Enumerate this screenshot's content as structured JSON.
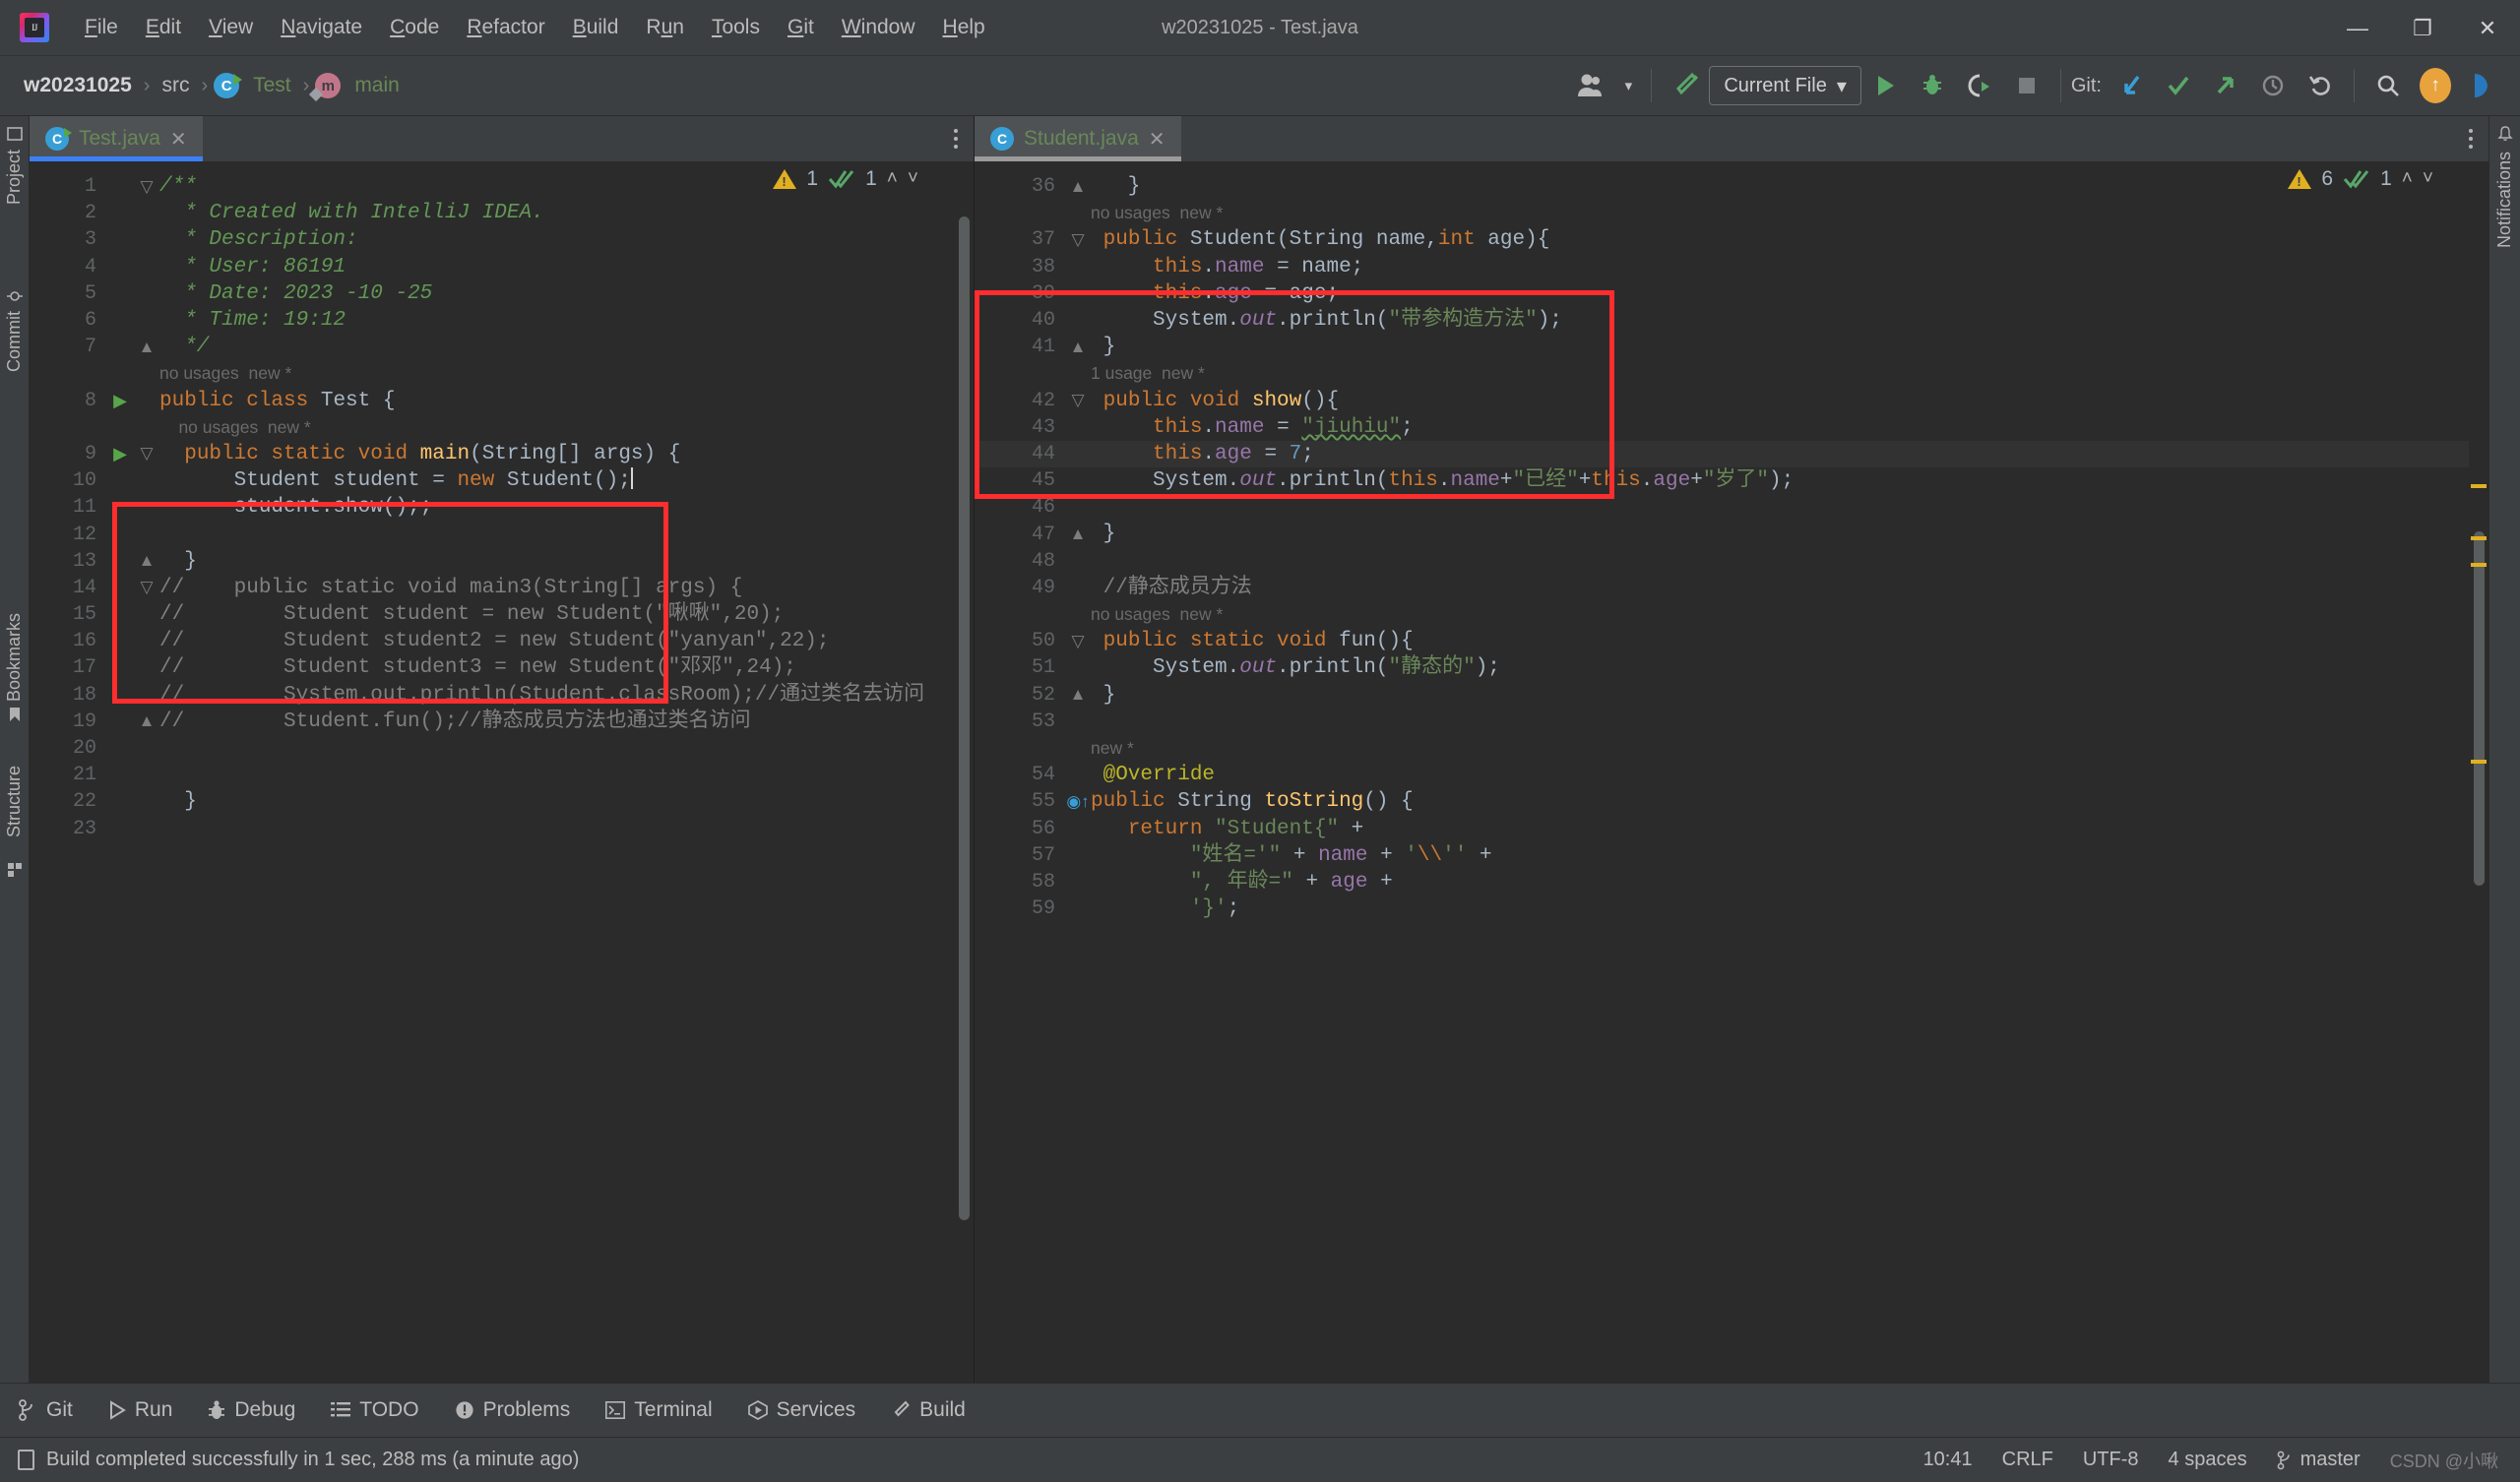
{
  "window": {
    "title": "w20231025 - Test.java",
    "minimize": "—",
    "maximize": "❐",
    "close": "✕"
  },
  "menubar": {
    "logo_text": "IJ",
    "items": [
      {
        "pre": "",
        "mn": "F",
        "post": "ile"
      },
      {
        "pre": "",
        "mn": "E",
        "post": "dit"
      },
      {
        "pre": "",
        "mn": "V",
        "post": "iew"
      },
      {
        "pre": "",
        "mn": "N",
        "post": "avigate"
      },
      {
        "pre": "",
        "mn": "C",
        "post": "ode"
      },
      {
        "pre": "",
        "mn": "R",
        "post": "efactor"
      },
      {
        "pre": "",
        "mn": "B",
        "post": "uild"
      },
      {
        "pre": "R",
        "mn": "u",
        "post": "n"
      },
      {
        "pre": "",
        "mn": "T",
        "post": "ools"
      },
      {
        "pre": "",
        "mn": "G",
        "post": "it"
      },
      {
        "pre": "",
        "mn": "W",
        "post": "indow"
      },
      {
        "pre": "",
        "mn": "H",
        "post": "elp"
      }
    ]
  },
  "navbar": {
    "breadcrumbs": [
      {
        "label": "w20231025",
        "style": "bold",
        "icon": ""
      },
      {
        "label": "src",
        "style": "plain",
        "icon": ""
      },
      {
        "label": "Test",
        "style": "green",
        "icon": "class-icon"
      },
      {
        "label": "main",
        "style": "green",
        "icon": "method-icon"
      }
    ],
    "separator": "›",
    "run_config": "Current File",
    "run_config_caret": "▾",
    "git_label": "Git:",
    "buttons": [
      {
        "name": "profile-dropdown",
        "glyph": "👤"
      },
      {
        "name": "build-hammer",
        "glyph": "hammer"
      },
      {
        "name": "run-button",
        "glyph": "▶"
      },
      {
        "name": "debug-button",
        "glyph": "bug"
      },
      {
        "name": "run-with-coverage",
        "glyph": "coverage"
      },
      {
        "name": "stop-button",
        "glyph": "■"
      },
      {
        "name": "git-update",
        "glyph": "↙"
      },
      {
        "name": "git-commit",
        "glyph": "✓"
      },
      {
        "name": "git-push",
        "glyph": "↗"
      },
      {
        "name": "git-history",
        "glyph": "◴"
      },
      {
        "name": "git-rollback",
        "glyph": "↶"
      },
      {
        "name": "search-everywhere",
        "glyph": "⌕"
      },
      {
        "name": "update-available",
        "glyph": "↑"
      },
      {
        "name": "ide-assistant",
        "glyph": "◖"
      }
    ]
  },
  "stripes": {
    "left": [
      "Project",
      "Commit",
      "Bookmarks",
      "Structure"
    ],
    "right": [
      "Notifications"
    ]
  },
  "left_editor": {
    "tab": {
      "label": "Test.java",
      "icon": "java-class-run-icon",
      "close": "✕"
    },
    "kebab": "kebab-icon",
    "inspection": {
      "warnings": "1",
      "checks": "1",
      "up": "˄",
      "down": "˅"
    },
    "lines": [
      {
        "n": "1",
        "fold": "⊖",
        "code": "/**"
      },
      {
        "n": "2",
        "fold": "",
        "code": " * Created with IntelliJ IDEA."
      },
      {
        "n": "3",
        "fold": "",
        "code": " * Description:"
      },
      {
        "n": "4",
        "fold": "",
        "code": " * User: 86191"
      },
      {
        "n": "5",
        "fold": "",
        "code": " * Date: 2023 -10 -25"
      },
      {
        "n": "6",
        "fold": "",
        "code": " * Time: 19:12"
      },
      {
        "n": "7",
        "fold": "⊖",
        "code": " */"
      },
      {
        "n": "",
        "fold": "",
        "code": "no usages  new *",
        "kind": "hint"
      },
      {
        "n": "8",
        "fold": "",
        "run": "▶",
        "code": "public class Test {"
      },
      {
        "n": "",
        "fold": "",
        "code": "    no usages  new *",
        "kind": "hint"
      },
      {
        "n": "9",
        "fold": "⊖",
        "run": "▶",
        "code": "    public static void main(String[] args) {"
      },
      {
        "n": "10",
        "fold": "",
        "code": "        Student student = new Student();",
        "caret": true
      },
      {
        "n": "11",
        "fold": "",
        "code": "        student.show();;"
      },
      {
        "n": "12",
        "fold": "",
        "code": ""
      },
      {
        "n": "13",
        "fold": "⊖",
        "code": "    }"
      },
      {
        "n": "14",
        "fold": "⊖",
        "code": "//    public static void main3(String[] args) {"
      },
      {
        "n": "15",
        "fold": "",
        "code": "//        Student student = new Student(\"啾啾\",20);"
      },
      {
        "n": "16",
        "fold": "",
        "code": "//        Student student2 = new Student(\"yanyan\",22);"
      },
      {
        "n": "17",
        "fold": "",
        "code": "//        Student student3 = new Student(\"邓邓\",24);"
      },
      {
        "n": "18",
        "fold": "",
        "code": "//        System.out.println(Student.classRoom);//通过类名去访问"
      },
      {
        "n": "19",
        "fold": "⊖",
        "code": "//        Student.fun();//静态成员方法也通过类名访问"
      },
      {
        "n": "20",
        "fold": "",
        "code": ""
      },
      {
        "n": "21",
        "fold": "",
        "code": ""
      },
      {
        "n": "22",
        "fold": "",
        "code": "    }"
      },
      {
        "n": "23",
        "fold": "",
        "code": ""
      }
    ]
  },
  "right_editor": {
    "tab": {
      "label": "Student.java",
      "icon": "java-class-icon",
      "close": "✕"
    },
    "kebab": "kebab-icon",
    "inspection": {
      "warnings": "6",
      "checks": "1",
      "up": "˄",
      "down": "˅"
    },
    "lines": [
      {
        "n": "36",
        "fold": "⊖",
        "code": "    }"
      },
      {
        "n": "",
        "fold": "",
        "code": "no usages  new *",
        "kind": "hint"
      },
      {
        "n": "37",
        "fold": "⊖",
        "code": "public Student(String name,int age){"
      },
      {
        "n": "38",
        "fold": "",
        "code": "    this.name = name;"
      },
      {
        "n": "39",
        "fold": "",
        "code": "    this.age = age;"
      },
      {
        "n": "40",
        "fold": "",
        "code": "    System.out.println(\"带参构造方法\");"
      },
      {
        "n": "41",
        "fold": "⊖",
        "code": "}"
      },
      {
        "n": "",
        "fold": "",
        "code": "1 usage  new *",
        "kind": "hint"
      },
      {
        "n": "42",
        "fold": "⊖",
        "code": "public void show(){"
      },
      {
        "n": "43",
        "fold": "",
        "code": "    this.name = \"jiuhiu\";"
      },
      {
        "n": "44",
        "fold": "",
        "code": "    this.age = 7;",
        "hl": true
      },
      {
        "n": "45",
        "fold": "",
        "code": "    System.out.println(this.name+\"已经\"+this.age+\"岁了\");"
      },
      {
        "n": "46",
        "fold": "",
        "code": ""
      },
      {
        "n": "47",
        "fold": "⊖",
        "code": "}"
      },
      {
        "n": "48",
        "fold": "",
        "code": ""
      },
      {
        "n": "49",
        "fold": "",
        "code": "//静态成员方法"
      },
      {
        "n": "",
        "fold": "",
        "code": "no usages  new *",
        "kind": "hint"
      },
      {
        "n": "50",
        "fold": "⊖",
        "code": "public static void fun(){"
      },
      {
        "n": "51",
        "fold": "",
        "code": "    System.out.println(\"静态的\");"
      },
      {
        "n": "52",
        "fold": "⊖",
        "code": "}"
      },
      {
        "n": "53",
        "fold": "",
        "code": ""
      },
      {
        "n": "",
        "fold": "",
        "code": "new *",
        "kind": "hint"
      },
      {
        "n": "54",
        "fold": "",
        "code": "@Override"
      },
      {
        "n": "55",
        "fold": "⊖",
        "code": "public String toString() {",
        "override": true
      },
      {
        "n": "56",
        "fold": "",
        "code": "    return \"Student{\" +"
      },
      {
        "n": "57",
        "fold": "",
        "code": "            \"姓名='\" + name + '\\'' +"
      },
      {
        "n": "58",
        "fold": "",
        "code": "            \", 年龄=\" + age +"
      },
      {
        "n": "59",
        "fold": "",
        "code": "            '}';"
      }
    ]
  },
  "bottom_tools": [
    {
      "label": "Git",
      "icon": "git-branch-icon"
    },
    {
      "label": "Run",
      "icon": "run-icon"
    },
    {
      "label": "Debug",
      "icon": "debug-bug-icon"
    },
    {
      "label": "TODO",
      "icon": "todo-list-icon"
    },
    {
      "label": "Problems",
      "icon": "problems-icon"
    },
    {
      "label": "Terminal",
      "icon": "terminal-icon"
    },
    {
      "label": "Services",
      "icon": "services-icon"
    },
    {
      "label": "Build",
      "icon": "build-hammer-icon"
    }
  ],
  "status": {
    "message": "Build completed successfully in 1 sec, 288 ms (a minute ago)",
    "caret_position": "10:41",
    "line_separator": "CRLF",
    "encoding": "UTF-8",
    "indent": "4 spaces",
    "branch": "master",
    "watermark": "CSDN @小啾"
  },
  "colors": {
    "accent_blue": "#3c80f7",
    "annotation_red": "#ff2d2d",
    "keyword_orange": "#cc7832",
    "string_green": "#6a8759",
    "comment_green": "#629755",
    "field_purple": "#9876aa",
    "method_yellow": "#ffc66d",
    "number_blue": "#6897bb",
    "warning_yellow": "#e0b020",
    "bg_editor": "#2b2b2b",
    "bg_chrome": "#3c3f41"
  }
}
